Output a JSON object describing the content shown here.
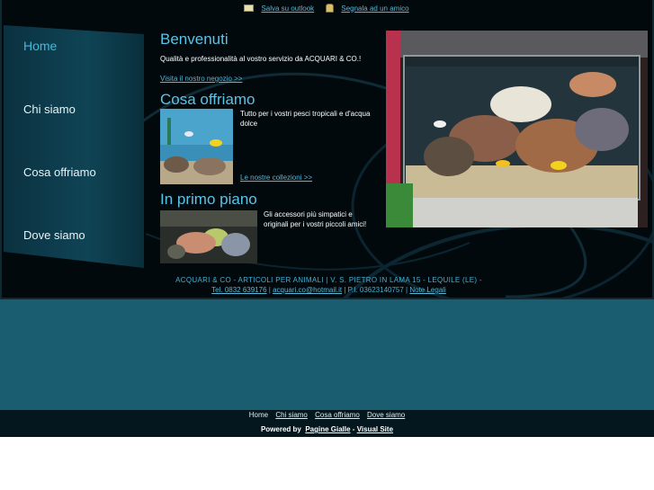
{
  "topbar": {
    "save_outlook": "Salva su outlook",
    "report_friend": "Segnala ad un amico"
  },
  "nav": {
    "items": [
      "Home",
      "Chi siamo",
      "Cosa offriamo",
      "Dove siamo"
    ],
    "active": "Home"
  },
  "welcome": {
    "title": "Benvenuti",
    "text": "Qualità e professionalità al vostro servizio da ACQUARI & CO.!",
    "link": "Visita il nostro negozio >>"
  },
  "offer": {
    "title": "Cosa offriamo",
    "text": "Tutto per i vostri pesci tropicali e d'acqua dolce",
    "link": "Le nostre collezioni >>"
  },
  "highlight": {
    "title": "In primo piano",
    "text": "Gli accessori più simpatici e originali per i vostri piccoli amici!"
  },
  "footer_info": {
    "line1": "ACQUARI & CO - ARTICOLI PER ANIMALI | V. S. PIETRO IN LAMA 15 - LEQUILE (LE) -",
    "tel": "Tel. 0832 639176",
    "email": "acquari.co@hotmail.it",
    "piva": "P.I. 03623140757",
    "legal": "Note Legali"
  },
  "bottom_nav": {
    "home": "Home",
    "chi_siamo": "Chi siamo",
    "cosa_offriamo": "Cosa offriamo",
    "dove_siamo": "Dove siamo"
  },
  "powered": {
    "prefix": "Powered by",
    "pagine_gialle": "Pagine Gialle",
    "separator": "-",
    "visual_site": "Visual Site"
  },
  "colors": {
    "frame_bg": "#02090d",
    "accent": "#5ac3e8",
    "band": "#1a5c70",
    "bottom_bar": "#04161e"
  }
}
